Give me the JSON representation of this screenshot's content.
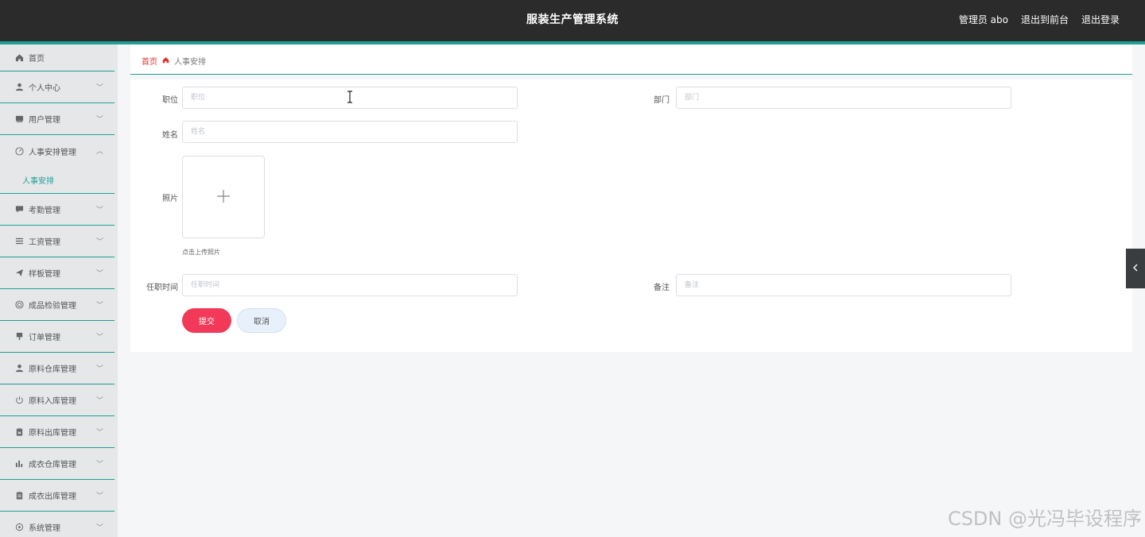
{
  "header": {
    "title": "服装生产管理系统",
    "user": "管理员 abo",
    "to_front": "退出到前台",
    "logout": "退出登录"
  },
  "sidebar": {
    "items": [
      {
        "label": "首页",
        "icon": "home-icon"
      },
      {
        "label": "个人中心",
        "icon": "person-icon"
      },
      {
        "label": "用户管理",
        "icon": "card-icon"
      },
      {
        "label": "人事安排管理",
        "icon": "dashboard-icon",
        "expanded": true,
        "children": [
          "人事安排"
        ]
      },
      {
        "label": "考勤管理",
        "icon": "chat-icon"
      },
      {
        "label": "工资管理",
        "icon": "list-icon"
      },
      {
        "label": "样板管理",
        "icon": "send-icon"
      },
      {
        "label": "成品检验管理",
        "icon": "target-icon"
      },
      {
        "label": "订单管理",
        "icon": "pin-icon"
      },
      {
        "label": "原料仓库管理",
        "icon": "user-icon"
      },
      {
        "label": "原料入库管理",
        "icon": "power-icon"
      },
      {
        "label": "原料出库管理",
        "icon": "clipboard-icon"
      },
      {
        "label": "成衣仓库管理",
        "icon": "bar-chart-icon"
      },
      {
        "label": "成衣出库管理",
        "icon": "clipboard-icon"
      },
      {
        "label": "系统管理",
        "icon": "gear-icon"
      }
    ]
  },
  "breadcrumb": {
    "home": "首页",
    "current": "人事安排"
  },
  "form": {
    "position_label": "职位",
    "position_placeholder": "职位",
    "dept_label": "部门",
    "dept_placeholder": "部门",
    "name_label": "姓名",
    "name_placeholder": "姓名",
    "photo_label": "照片",
    "photo_hint": "点击上传照片",
    "time_label": "任职时间",
    "time_placeholder": "任职时间",
    "note_label": "备注",
    "note_placeholder": "备注",
    "submit": "提交",
    "cancel": "取消"
  },
  "watermark": "CSDN @光冯毕设程序",
  "colors": {
    "accent": "#1f9f94",
    "header_bg": "#2b2b2b",
    "submit": "#f2395a",
    "breadcrumb_home": "#e0302f"
  }
}
